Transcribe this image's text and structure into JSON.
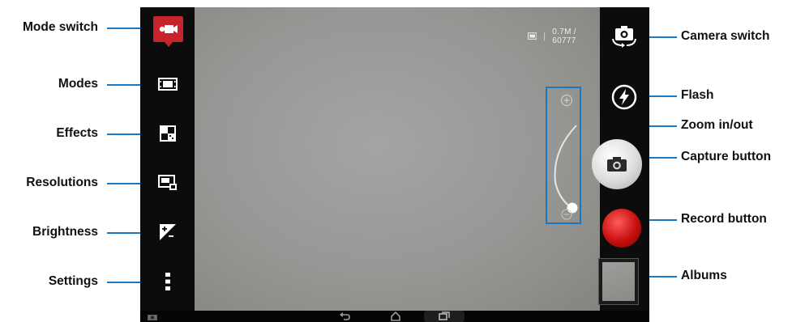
{
  "callouts": {
    "left": [
      "Mode switch",
      "Modes",
      "Effects",
      "Resolutions",
      "Brightness",
      "Settings"
    ],
    "right": [
      "Camera switch",
      "Flash",
      "Zoom in/out",
      "Capture button",
      "Record button",
      "Albums"
    ]
  },
  "viewfinder": {
    "storage_text": "0.7M / 60777",
    "storage_separator": "|"
  },
  "icons": {
    "mode_switch": "video-camera-icon",
    "modes": "film-frame-icon",
    "effects": "effects-squares-icon",
    "resolutions": "resolution-icon",
    "brightness": "exposure-icon",
    "settings": "more-vertical-icon",
    "camera_switch": "camera-switch-icon",
    "flash": "flash-auto-icon",
    "capture": "camera-icon",
    "nav_back": "back-arrow-icon",
    "nav_home": "home-icon",
    "nav_recent": "recent-apps-icon"
  },
  "colors": {
    "callout_line": "#1a78c2",
    "mode_switch_bg": "#c8222a",
    "record": "#c70f0f"
  }
}
